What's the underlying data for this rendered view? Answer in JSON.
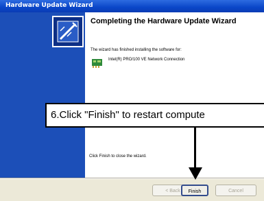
{
  "window": {
    "title": "Hardware Update Wizard"
  },
  "wizard": {
    "heading": "Completing the Hardware Update Wizard",
    "description": "The wizard has finished installing the software for:",
    "device_name": "Intel(R) PRO/100 VE Network Connection",
    "finish_hint": "Click Finish to close the wizard."
  },
  "buttons": {
    "back": "< Back",
    "finish": "Finish",
    "cancel": "Cancel"
  },
  "callout": {
    "text": "6.Click \"Finish\" to restart compute"
  },
  "colors": {
    "titlebar": "#0a46c8",
    "left_panel": "#1c4fb8",
    "dialog_bg": "#ece9d8"
  },
  "icons": {
    "wizard": "hardware-wizard-icon",
    "device": "network-card-icon"
  }
}
